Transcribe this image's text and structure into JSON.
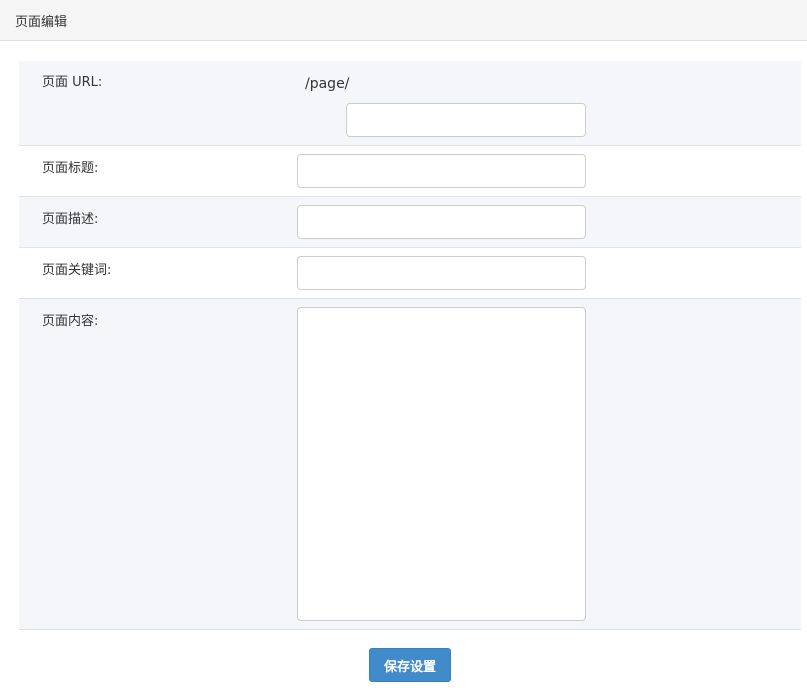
{
  "header": {
    "title": "页面编辑"
  },
  "form": {
    "url": {
      "label": "页面 URL:",
      "prefix": "/page/",
      "value": ""
    },
    "title": {
      "label": "页面标题:",
      "value": ""
    },
    "description": {
      "label": "页面描述:",
      "value": ""
    },
    "keywords": {
      "label": "页面关键词:",
      "value": ""
    },
    "content": {
      "label": "页面内容:",
      "value": ""
    }
  },
  "actions": {
    "save_label": "保存设置"
  },
  "colors": {
    "accent": "#428bca",
    "row_alt_bg": "#f4f6f9",
    "header_bg": "#f5f5f5"
  }
}
